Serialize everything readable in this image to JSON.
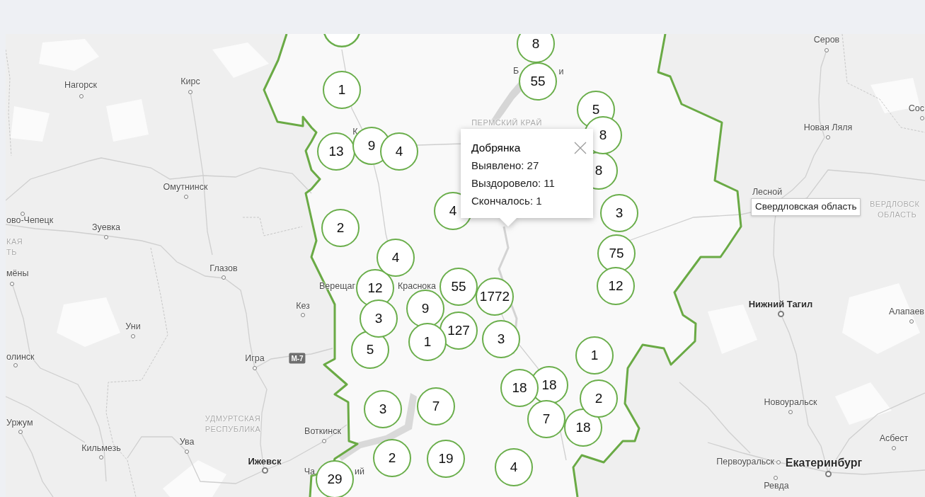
{
  "map": {
    "place_labels": [
      {
        "text": "Серов",
        "kind": "town"
      },
      {
        "text": "Нагорск",
        "kind": "town"
      },
      {
        "text": "Кирс",
        "kind": "town"
      },
      {
        "text": "Б",
        "kind": "label"
      },
      {
        "text": "и",
        "kind": "label"
      },
      {
        "text": "Сос",
        "kind": "town"
      },
      {
        "text": "Новая Ляля",
        "kind": "town"
      },
      {
        "text": "ПЕРМСКИЙ КРАЙ",
        "kind": "region"
      },
      {
        "text": "К",
        "kind": "label"
      },
      {
        "text": "Омутнинск",
        "kind": "town"
      },
      {
        "text": "Лесной",
        "kind": "label"
      },
      {
        "text": "ово-Чепецк",
        "kind": "town"
      },
      {
        "text": "Зуевка",
        "kind": "town"
      },
      {
        "text": "КАЯ",
        "kind": "region"
      },
      {
        "text": "ТЬ",
        "kind": "region"
      },
      {
        "text": "ВЕРДЛОВСК",
        "kind": "region"
      },
      {
        "text": "ОБЛАСТЬ",
        "kind": "region"
      },
      {
        "text": "мёны",
        "kind": "town"
      },
      {
        "text": "Глазов",
        "kind": "town"
      },
      {
        "text": "Верещаг",
        "kind": "label"
      },
      {
        "text": "Краснока",
        "kind": "label"
      },
      {
        "text": "Нижний Тагил",
        "kind": "city"
      },
      {
        "text": "Кез",
        "kind": "town"
      },
      {
        "text": "Алапаев",
        "kind": "town"
      },
      {
        "text": "Уни",
        "kind": "town"
      },
      {
        "text": "олинск",
        "kind": "town"
      },
      {
        "text": "Игра",
        "kind": "town"
      },
      {
        "text": "Новоуральск",
        "kind": "town"
      },
      {
        "text": "УДМУРТСКАЯ",
        "kind": "region"
      },
      {
        "text": "РЕСПУБЛИКА",
        "kind": "region"
      },
      {
        "text": "Уржум",
        "kind": "town"
      },
      {
        "text": "Воткинск",
        "kind": "town"
      },
      {
        "text": "Асбест",
        "kind": "town"
      },
      {
        "text": "Ува",
        "kind": "town"
      },
      {
        "text": "Кильмезь",
        "kind": "town"
      },
      {
        "text": "Ижевск",
        "kind": "city"
      },
      {
        "text": "Первоуральск",
        "kind": "town"
      },
      {
        "text": "Екатеринбург",
        "kind": "city"
      },
      {
        "text": "Ча",
        "kind": "label"
      },
      {
        "text": "ий",
        "kind": "label"
      },
      {
        "text": "Ревда",
        "kind": "town"
      }
    ],
    "highway_sign": "М-7",
    "clusters": [
      {
        "clipped": true
      },
      {
        "count": "8",
        "clipped": false
      },
      {
        "count": "1",
        "clipped": false
      },
      {
        "count": "55",
        "clipped": false
      },
      {
        "count": "5",
        "clipped": false
      },
      {
        "count": "8",
        "clipped": false
      },
      {
        "count": "13",
        "clipped": false
      },
      {
        "count": "9",
        "clipped": false
      },
      {
        "count": "4",
        "clipped": false
      },
      {
        "count": "8",
        "clipped": false
      },
      {
        "count": "4",
        "clipped": false
      },
      {
        "count": "3",
        "clipped": false
      },
      {
        "count": "2",
        "clipped": false
      },
      {
        "count": "4",
        "clipped": false
      },
      {
        "count": "75",
        "clipped": false
      },
      {
        "count": "12",
        "clipped": false
      },
      {
        "count": "55",
        "clipped": false
      },
      {
        "count": "1772",
        "clipped": false
      },
      {
        "count": "12",
        "clipped": false
      },
      {
        "count": "9",
        "clipped": false
      },
      {
        "count": "3",
        "clipped": false
      },
      {
        "count": "127",
        "clipped": false
      },
      {
        "count": "1",
        "clipped": false
      },
      {
        "count": "3",
        "clipped": false
      },
      {
        "count": "5",
        "clipped": false
      },
      {
        "count": "1",
        "clipped": false
      },
      {
        "count": "18",
        "clipped": false
      },
      {
        "count": "18",
        "clipped": false
      },
      {
        "count": "2",
        "clipped": false
      },
      {
        "count": "3",
        "clipped": false
      },
      {
        "count": "7",
        "clipped": false
      },
      {
        "count": "7",
        "clipped": false
      },
      {
        "count": "18",
        "clipped": false
      },
      {
        "count": "2",
        "clipped": false
      },
      {
        "count": "19",
        "clipped": false
      },
      {
        "count": "4",
        "clipped": false
      },
      {
        "count": "29",
        "clipped": false
      }
    ]
  },
  "popup": {
    "title": "Добрянка",
    "lines": [
      "Выявлено: 27",
      "Выздоровело: 11",
      "Скончалось: 1"
    ]
  },
  "tooltip": {
    "text": "Свердловская область"
  }
}
